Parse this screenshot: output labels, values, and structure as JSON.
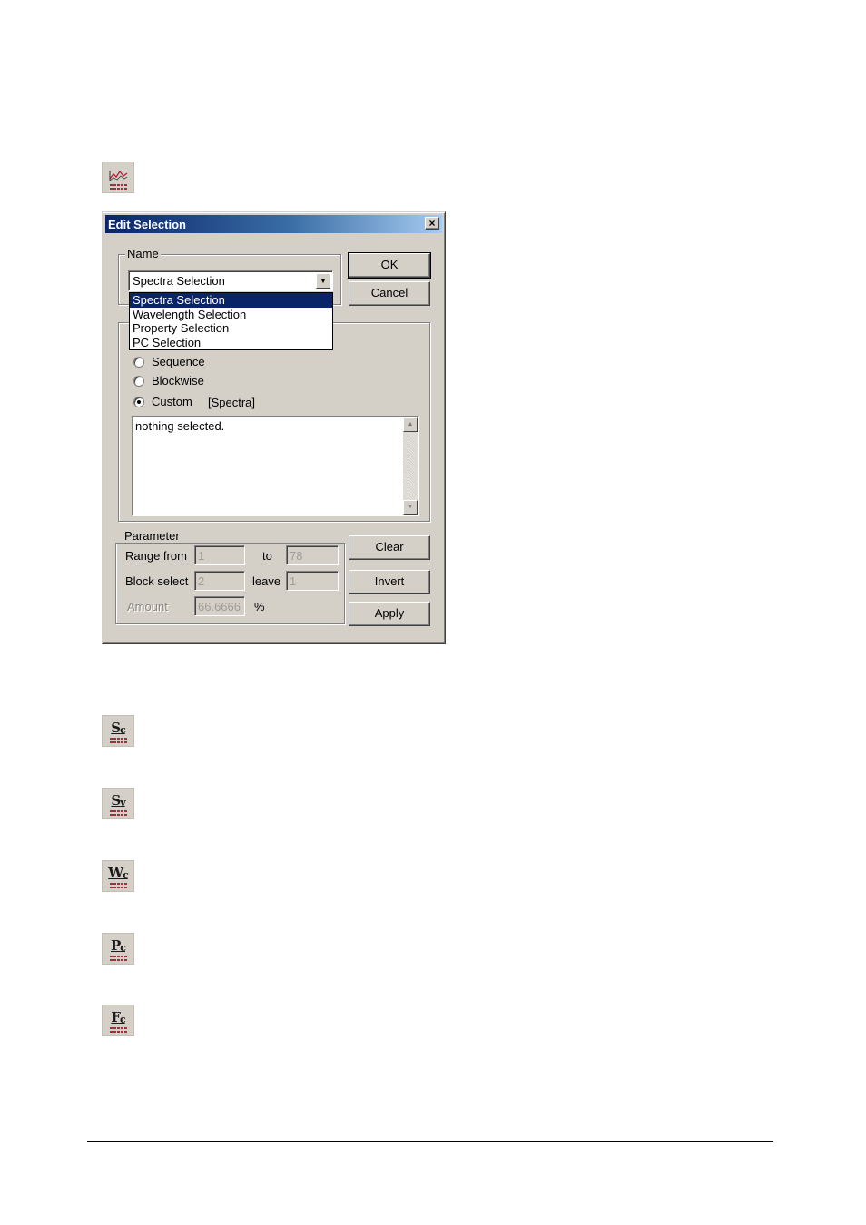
{
  "toolbar_icons": [
    {
      "name": "edit-selection-icon",
      "glyph": "≋"
    },
    {
      "name": "sc-icon",
      "glyph": "S",
      "sub": "c"
    },
    {
      "name": "sv-icon",
      "glyph": "S",
      "sub": "v"
    },
    {
      "name": "wc-icon",
      "glyph": "W",
      "sub": "c"
    },
    {
      "name": "pc-icon",
      "glyph": "P",
      "sub": "c"
    },
    {
      "name": "fc-icon",
      "glyph": "F",
      "sub": "c"
    }
  ],
  "dialog": {
    "title": "Edit Selection",
    "close_label": "×",
    "name_group_label": "Name",
    "combo_value": "Spectra Selection",
    "dropdown_options": [
      "Spectra Selection",
      "Wavelength Selection",
      "Property Selection",
      "PC Selection"
    ],
    "ok_label": "OK",
    "cancel_label": "Cancel",
    "radio_sequence": "Sequence",
    "radio_blockwise": "Blockwise",
    "radio_custom": "Custom",
    "custom_tag": "[Spectra]",
    "textarea_text": "nothing selected.",
    "parameter_group_label": "Parameter",
    "range_from_label": "Range from",
    "range_from_value": "1",
    "to_label": "to",
    "to_value": "78",
    "block_select_label": "Block select",
    "block_select_value": "2",
    "leave_label": "leave",
    "leave_value": "1",
    "amount_label": "Amount",
    "amount_value": "66.6666",
    "percent_label": "%",
    "clear_label": "Clear",
    "invert_label": "Invert",
    "apply_label": "Apply"
  }
}
